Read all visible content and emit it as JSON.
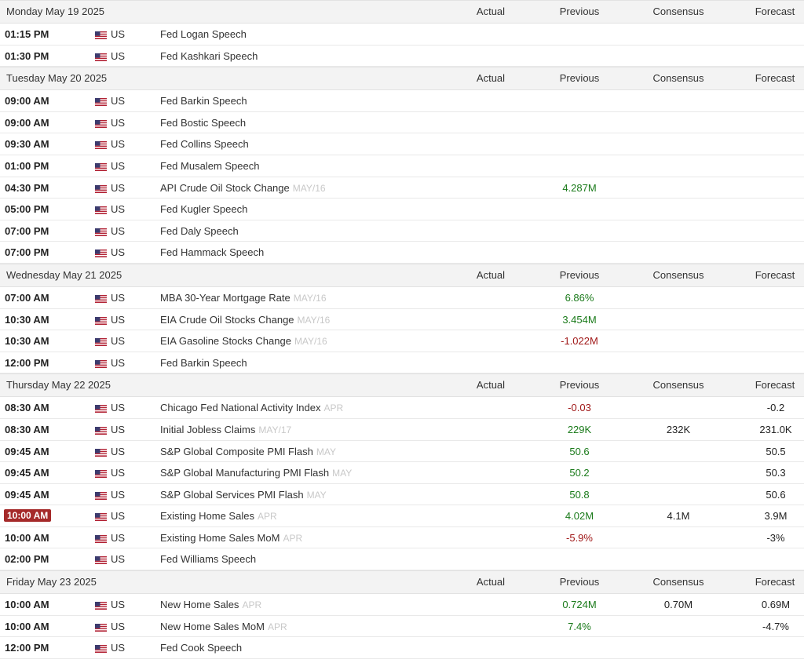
{
  "columns": {
    "actual": "Actual",
    "previous": "Previous",
    "consensus": "Consensus",
    "forecast": "Forecast"
  },
  "colors": {
    "positive": "#1a7a1a",
    "negative": "#a01818",
    "current_time_badge": "#a52a2a",
    "header_bg": "#f3f3f3"
  },
  "days": [
    {
      "date": "Monday May 19 2025",
      "events": [
        {
          "time": "01:15 PM",
          "country": "US",
          "event": "Fed Logan Speech",
          "period": "",
          "actual": "",
          "previous": "",
          "previous_dir": "",
          "consensus": "",
          "forecast": ""
        },
        {
          "time": "01:30 PM",
          "country": "US",
          "event": "Fed Kashkari Speech",
          "period": "",
          "actual": "",
          "previous": "",
          "previous_dir": "",
          "consensus": "",
          "forecast": ""
        }
      ]
    },
    {
      "date": "Tuesday May 20 2025",
      "events": [
        {
          "time": "09:00 AM",
          "country": "US",
          "event": "Fed Barkin Speech",
          "period": "",
          "actual": "",
          "previous": "",
          "previous_dir": "",
          "consensus": "",
          "forecast": ""
        },
        {
          "time": "09:00 AM",
          "country": "US",
          "event": "Fed Bostic Speech",
          "period": "",
          "actual": "",
          "previous": "",
          "previous_dir": "",
          "consensus": "",
          "forecast": ""
        },
        {
          "time": "09:30 AM",
          "country": "US",
          "event": "Fed Collins Speech",
          "period": "",
          "actual": "",
          "previous": "",
          "previous_dir": "",
          "consensus": "",
          "forecast": ""
        },
        {
          "time": "01:00 PM",
          "country": "US",
          "event": "Fed Musalem Speech",
          "period": "",
          "actual": "",
          "previous": "",
          "previous_dir": "",
          "consensus": "",
          "forecast": ""
        },
        {
          "time": "04:30 PM",
          "country": "US",
          "event": "API Crude Oil Stock Change",
          "period": "MAY/16",
          "actual": "",
          "previous": "4.287M",
          "previous_dir": "pos",
          "consensus": "",
          "forecast": ""
        },
        {
          "time": "05:00 PM",
          "country": "US",
          "event": "Fed Kugler Speech",
          "period": "",
          "actual": "",
          "previous": "",
          "previous_dir": "",
          "consensus": "",
          "forecast": ""
        },
        {
          "time": "07:00 PM",
          "country": "US",
          "event": "Fed Daly Speech",
          "period": "",
          "actual": "",
          "previous": "",
          "previous_dir": "",
          "consensus": "",
          "forecast": ""
        },
        {
          "time": "07:00 PM",
          "country": "US",
          "event": "Fed Hammack Speech",
          "period": "",
          "actual": "",
          "previous": "",
          "previous_dir": "",
          "consensus": "",
          "forecast": ""
        }
      ]
    },
    {
      "date": "Wednesday May 21 2025",
      "events": [
        {
          "time": "07:00 AM",
          "country": "US",
          "event": "MBA 30-Year Mortgage Rate",
          "period": "MAY/16",
          "actual": "",
          "previous": "6.86%",
          "previous_dir": "pos",
          "consensus": "",
          "forecast": ""
        },
        {
          "time": "10:30 AM",
          "country": "US",
          "event": "EIA Crude Oil Stocks Change",
          "period": "MAY/16",
          "actual": "",
          "previous": "3.454M",
          "previous_dir": "pos",
          "consensus": "",
          "forecast": ""
        },
        {
          "time": "10:30 AM",
          "country": "US",
          "event": "EIA Gasoline Stocks Change",
          "period": "MAY/16",
          "actual": "",
          "previous": "-1.022M",
          "previous_dir": "neg",
          "consensus": "",
          "forecast": ""
        },
        {
          "time": "12:00 PM",
          "country": "US",
          "event": "Fed Barkin Speech",
          "period": "",
          "actual": "",
          "previous": "",
          "previous_dir": "",
          "consensus": "",
          "forecast": ""
        }
      ]
    },
    {
      "date": "Thursday May 22 2025",
      "events": [
        {
          "time": "08:30 AM",
          "country": "US",
          "event": "Chicago Fed National Activity Index",
          "period": "APR",
          "actual": "",
          "previous": "-0.03",
          "previous_dir": "neg",
          "consensus": "",
          "forecast": "-0.2"
        },
        {
          "time": "08:30 AM",
          "country": "US",
          "event": "Initial Jobless Claims",
          "period": "MAY/17",
          "actual": "",
          "previous": "229K",
          "previous_dir": "pos",
          "consensus": "232K",
          "forecast": "231.0K"
        },
        {
          "time": "09:45 AM",
          "country": "US",
          "event": "S&P Global Composite PMI Flash",
          "period": "MAY",
          "actual": "",
          "previous": "50.6",
          "previous_dir": "pos",
          "consensus": "",
          "forecast": "50.5"
        },
        {
          "time": "09:45 AM",
          "country": "US",
          "event": "S&P Global Manufacturing PMI Flash",
          "period": "MAY",
          "actual": "",
          "previous": "50.2",
          "previous_dir": "pos",
          "consensus": "",
          "forecast": "50.3"
        },
        {
          "time": "09:45 AM",
          "country": "US",
          "event": "S&P Global Services PMI Flash",
          "period": "MAY",
          "actual": "",
          "previous": "50.8",
          "previous_dir": "pos",
          "consensus": "",
          "forecast": "50.6"
        },
        {
          "time": "10:00 AM",
          "current": true,
          "country": "US",
          "event": "Existing Home Sales",
          "period": "APR",
          "actual": "",
          "previous": "4.02M",
          "previous_dir": "pos",
          "consensus": "4.1M",
          "forecast": "3.9M"
        },
        {
          "time": "10:00 AM",
          "country": "US",
          "event": "Existing Home Sales MoM",
          "period": "APR",
          "actual": "",
          "previous": "-5.9%",
          "previous_dir": "neg",
          "consensus": "",
          "forecast": "-3%"
        },
        {
          "time": "02:00 PM",
          "country": "US",
          "event": "Fed Williams Speech",
          "period": "",
          "actual": "",
          "previous": "",
          "previous_dir": "",
          "consensus": "",
          "forecast": ""
        }
      ]
    },
    {
      "date": "Friday May 23 2025",
      "events": [
        {
          "time": "10:00 AM",
          "country": "US",
          "event": "New Home Sales",
          "period": "APR",
          "actual": "",
          "previous": "0.724M",
          "previous_dir": "pos",
          "consensus": "0.70M",
          "forecast": "0.69M"
        },
        {
          "time": "10:00 AM",
          "country": "US",
          "event": "New Home Sales MoM",
          "period": "APR",
          "actual": "",
          "previous": "7.4%",
          "previous_dir": "pos",
          "consensus": "",
          "forecast": "-4.7%"
        },
        {
          "time": "12:00 PM",
          "country": "US",
          "event": "Fed Cook Speech",
          "period": "",
          "actual": "",
          "previous": "",
          "previous_dir": "",
          "consensus": "",
          "forecast": ""
        }
      ]
    }
  ]
}
